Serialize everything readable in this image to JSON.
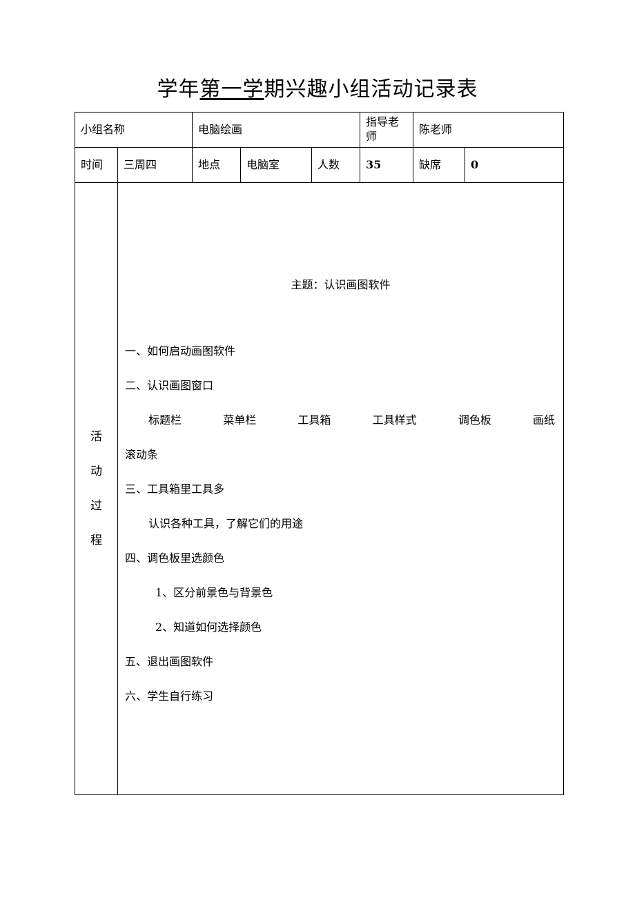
{
  "title": {
    "prefix": "学年",
    "underlined": "第一学",
    "suffix": "期兴趣小组活动记录表",
    "full": "学年第一学期兴趣小组活动记录表"
  },
  "table": {
    "row1": {
      "label_group_name": "小组名称",
      "value_group_name": "电脑绘画",
      "label_teacher": "指导老师",
      "value_teacher": "陈老师"
    },
    "row2": {
      "label_time": "时间",
      "value_time": "三周四",
      "label_place": "地点",
      "value_place": "电脑室",
      "label_count": "人数",
      "value_count": "35",
      "label_absent": "缺席",
      "value_absent": "0"
    },
    "body": {
      "vertical_label": [
        "活",
        "动",
        "过",
        "程"
      ],
      "subject": "主题：认识画图软件",
      "lines": {
        "item1": "一、如何启动画图软件",
        "item2": "二、认识画图窗口",
        "tools": [
          "标题栏",
          "菜单栏",
          "工具箱",
          "工具样式",
          "调色板",
          "画纸"
        ],
        "tools_wrap": "滚动条",
        "item3": "三、工具箱里工具多",
        "item3_sub": "认识各种工具，了解它们的用途",
        "item4": "四、调色板里选颜色",
        "item4_sub1": "1、区分前景色与背景色",
        "item4_sub2": "2、知道如何选择颜色",
        "item5": "五、退出画图软件",
        "item6": "六、学生自行练习"
      }
    }
  }
}
